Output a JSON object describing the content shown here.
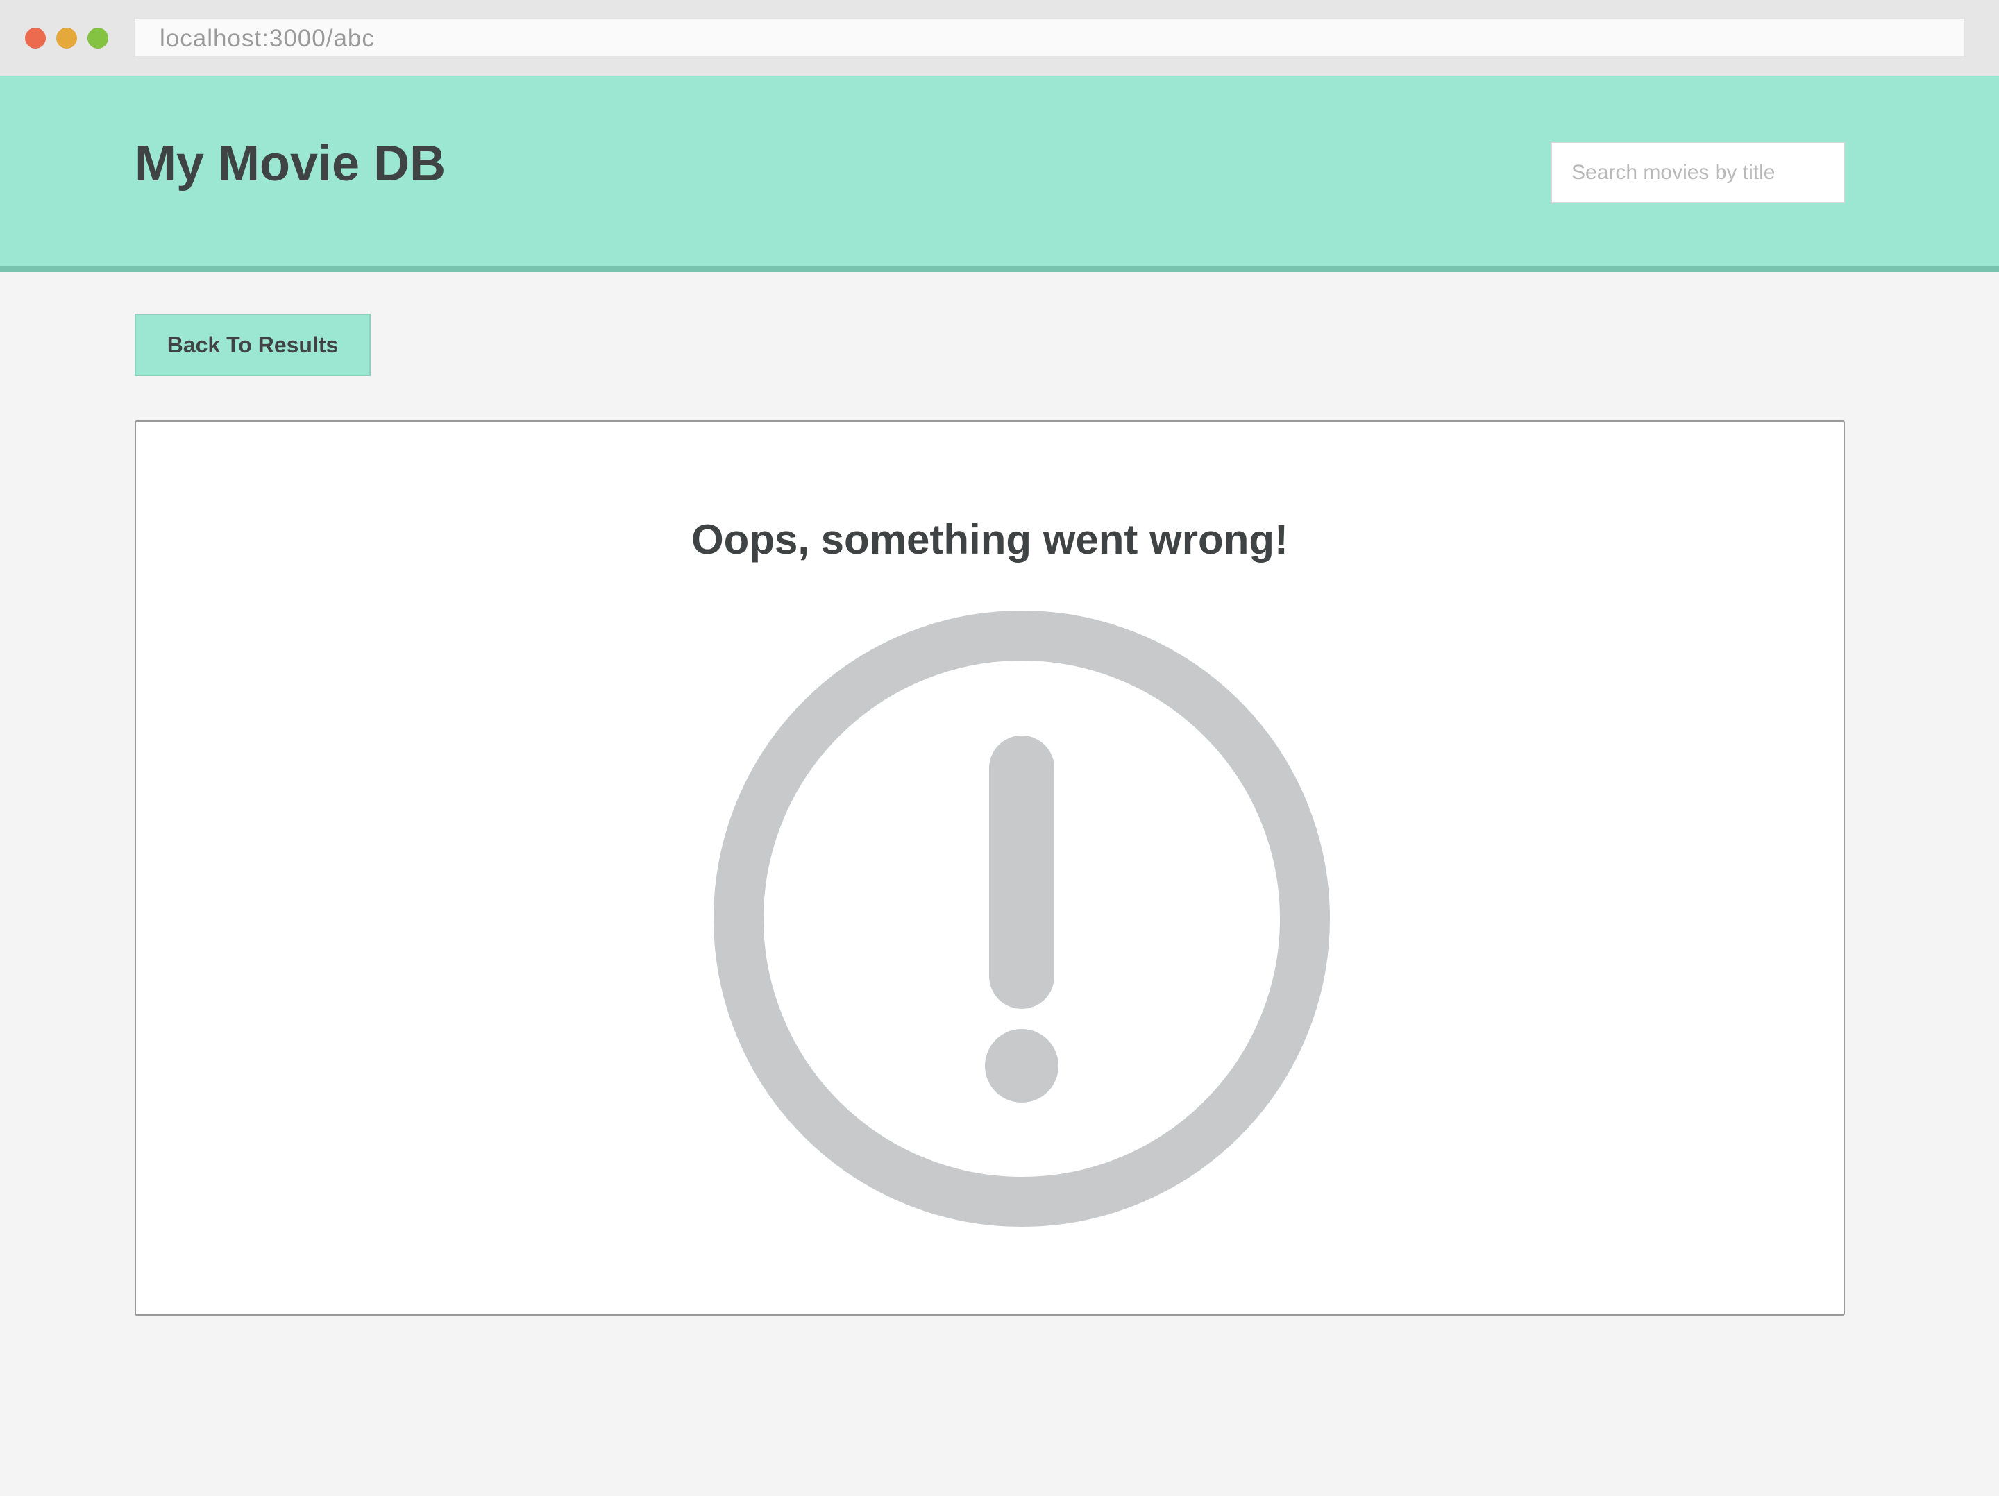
{
  "browser": {
    "url": "localhost:3000/abc"
  },
  "header": {
    "title": "My Movie DB",
    "search_placeholder": "Search movies by title"
  },
  "actions": {
    "back_label": "Back To Results"
  },
  "error": {
    "message": "Oops, something went wrong!",
    "icon": "exclamation-circle-icon"
  },
  "colors": {
    "accent": "#9be7d2",
    "accent_border": "#77c3ae",
    "icon": "#c8c9cb",
    "text": "#404343"
  }
}
